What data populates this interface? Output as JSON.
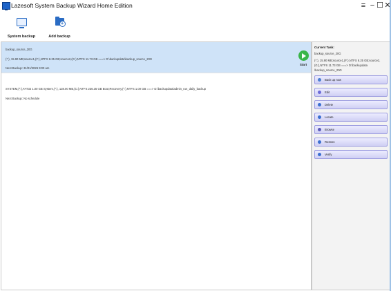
{
  "window": {
    "title": "Lazesoft System Backup Wizard Home Edition",
    "menu_icon": "hamburger-menu-icon",
    "minimize_icon": "minimize-icon",
    "maximize_icon": "maximize-icon",
    "close_icon": "close-icon"
  },
  "toolbar": {
    "system_backup_label": "System backup",
    "add_backup_label": "Add backup"
  },
  "tasks": [
    {
      "name": "backup_source_20G",
      "details": "(*:), 15.90 MB;source1,(F:),NTFS 8.25 GB;source2,(G:),NTFS 11.73 GB ===> D:\\backupdata\\backup_source_20G",
      "next_backup": "Next Backup: 31/01/2026 9:00 am",
      "selected": true
    },
    {
      "name": "",
      "details": "SYSTEM,(*:),FAT32 1.00 GB System,(*:), 128.00 MB,(C:),NTFS 236.35 GB Boot;Recovery,(*:),NTFS 1.00 GB ===> D:\\backupdata\\admin_run_daily_backup",
      "next_backup": "Next Backup: No schedule",
      "selected": false
    }
  ],
  "start_label": "Start",
  "current_task": {
    "heading": "Current Task:",
    "name": "backup_source_20G",
    "detail_line1": "(*:), 15.90 MB;source1,(F:),NTFS 8.25 GB;source2,",
    "detail_line2": "(G:),NTFS 11.73 GB ===> D:\\backupdata",
    "detail_line3": "\\backup_source_20G"
  },
  "actions": [
    {
      "label": "Back up now",
      "icon": "backup-now-icon",
      "color": "#4a7fd0"
    },
    {
      "label": "Edit",
      "icon": "edit-icon",
      "color": "#6b6bd8"
    },
    {
      "label": "Delete",
      "icon": "delete-icon",
      "color": "#3a6ed0"
    },
    {
      "label": "Locate",
      "icon": "locate-icon",
      "color": "#3a6ed0"
    },
    {
      "label": "Browse",
      "icon": "browse-icon",
      "color": "#5b5bb8"
    },
    {
      "label": "Restore",
      "icon": "restore-icon",
      "color": "#3a6ed0"
    },
    {
      "label": "Verify",
      "icon": "verify-icon",
      "color": "#3a6ed0"
    }
  ]
}
